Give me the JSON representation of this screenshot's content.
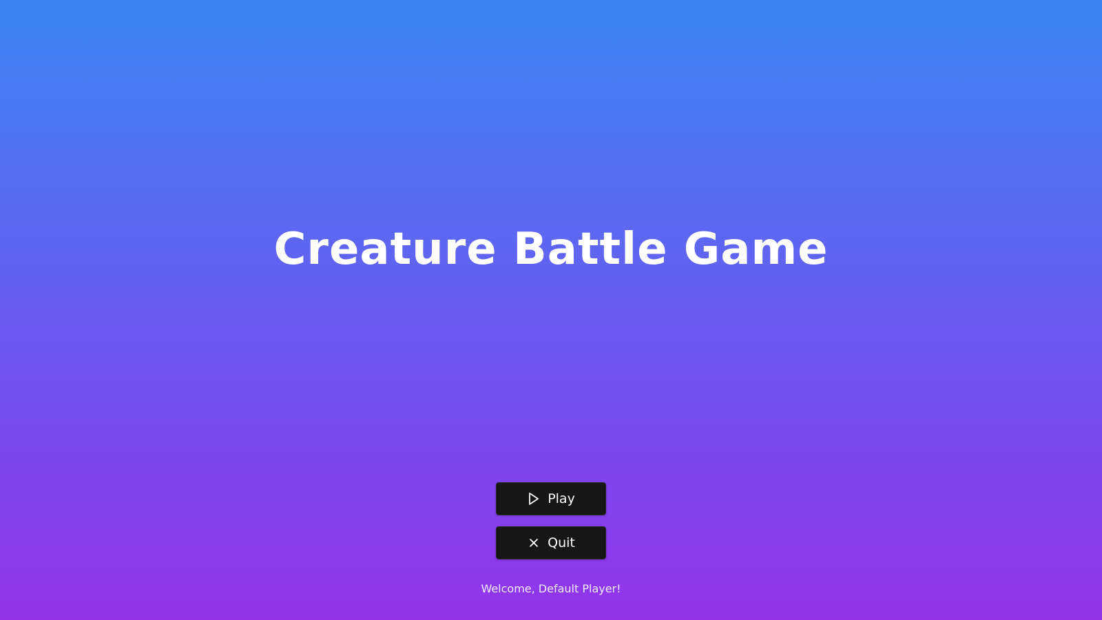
{
  "game": {
    "title": "Creature Battle Game"
  },
  "menu": {
    "play_label": "Play",
    "play_icon": "play-icon",
    "quit_label": "Quit",
    "quit_icon": "close-icon"
  },
  "status": {
    "welcome_text": "Welcome, Default Player!"
  },
  "colors": {
    "background_top": "#3b85f6",
    "background_bottom": "#9333ea",
    "button_bg": "#161616",
    "text": "#ffffff"
  }
}
